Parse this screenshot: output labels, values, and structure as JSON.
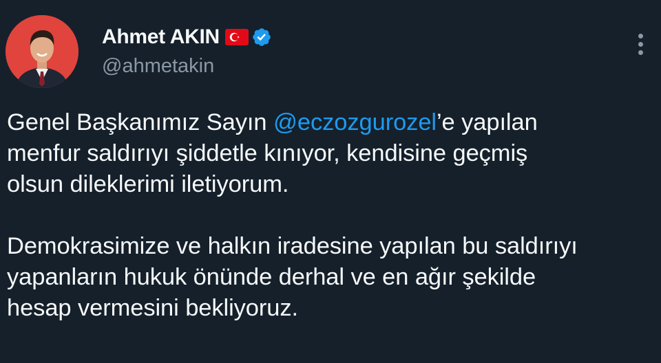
{
  "author": {
    "display_name": "Ahmet AKIN",
    "handle": "@ahmetakin",
    "flag_icon": "turkey-flag-icon",
    "verified_icon": "verified-badge-icon",
    "verified_color": "#1d9bf0"
  },
  "tweet": {
    "paragraph1": {
      "line1_before": "Genel Başkanımız Sayın ",
      "mention": "@eczozgurozel",
      "line1_after": "’e yapılan",
      "line2": "menfur saldırıyı şiddetle kınıyor, kendisine geçmiş",
      "line3": "olsun dileklerimi iletiyorum."
    },
    "paragraph2": {
      "line1": "Demokrasimize ve halkın iradesine yapılan bu saldırıyı",
      "line2": "yapanların hukuk önünde derhal ve en ağır şekilde",
      "line3": "hesap vermesini bekliyoruz."
    }
  },
  "menu": {
    "icon": "more-vertical-icon"
  },
  "colors": {
    "background": "#15202b",
    "text": "#f7f9f9",
    "secondary_text": "#8b98a5",
    "link": "#1d9bf0"
  }
}
